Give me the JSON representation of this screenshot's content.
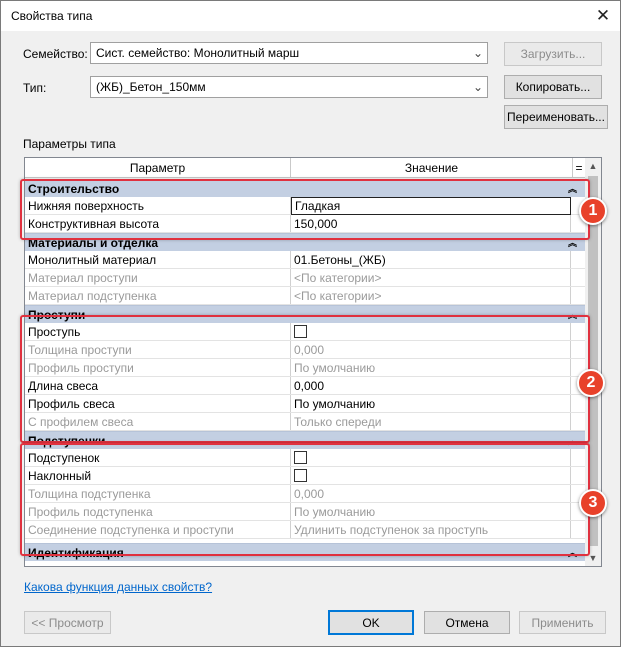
{
  "window": {
    "title": "Свойства типа"
  },
  "family": {
    "label": "Семейство:",
    "value": "Сист. семейство: Монолитный марш",
    "load_button": "Загрузить..."
  },
  "type": {
    "label": "Тип:",
    "value": "(ЖБ)_Бетон_150мм",
    "copy_button": "Копировать...",
    "rename_button": "Переименовать..."
  },
  "params_label": "Параметры типа",
  "grid": {
    "header_param": "Параметр",
    "header_value": "Значение",
    "header_extra": "=",
    "groups": [
      {
        "title": "Строительство",
        "rows": [
          {
            "param": "Нижняя поверхность",
            "value": "Гладкая"
          },
          {
            "param": "Конструктивная высота",
            "value": "150,000"
          }
        ]
      },
      {
        "title": "Материалы и отделка",
        "rows": [
          {
            "param": "Монолитный материал",
            "value": "01.Бетоны_(ЖБ)"
          },
          {
            "param": "Материал проступи",
            "value": "<По категории>"
          },
          {
            "param": "Материал подступенка",
            "value": "<По категории>"
          }
        ]
      },
      {
        "title": "Проступи",
        "rows": [
          {
            "param": "Проступь"
          },
          {
            "param": "Толщина проступи",
            "value": "0,000"
          },
          {
            "param": "Профиль проступи",
            "value": "По умолчанию"
          },
          {
            "param": "Длина свеса",
            "value": "0,000"
          },
          {
            "param": "Профиль свеса",
            "value": "По умолчанию"
          },
          {
            "param": "С профилем свеса",
            "value": "Только спереди"
          }
        ]
      },
      {
        "title": "Подступенки",
        "rows": [
          {
            "param": "Подступенок"
          },
          {
            "param": "Наклонный"
          },
          {
            "param": "Толщина подступенка",
            "value": "0,000"
          },
          {
            "param": "Профиль подступенка",
            "value": "По умолчанию"
          },
          {
            "param": "Соединение подступенка и проступи",
            "value": "Удлинить подступенок за проступь"
          }
        ]
      },
      {
        "title": "Идентификация"
      }
    ]
  },
  "badges": [
    "1",
    "2",
    "3"
  ],
  "help_link": "Какова функция данных свойств?",
  "footer": {
    "preview": "<< Просмотр",
    "ok": "OK",
    "cancel": "Отмена",
    "apply": "Применить"
  },
  "colors": {
    "group_header": "#c3cfe2",
    "highlight": "#e0313f",
    "badge": "#e8412a",
    "link": "#0066cc"
  }
}
